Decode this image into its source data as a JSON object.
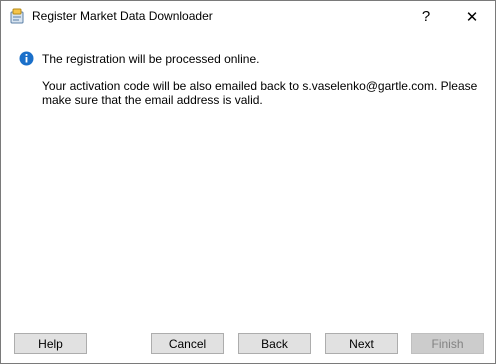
{
  "window": {
    "title": "Register Market Data Downloader",
    "help_glyph": "?",
    "close_glyph": "✕"
  },
  "message": {
    "lead": "The registration will be processed online.",
    "detail": "Your activation code will be also emailed back to s.vaselenko@gartle.com. Please make sure that the email address is valid."
  },
  "buttons": {
    "help": "Help",
    "cancel": "Cancel",
    "back": "Back",
    "next": "Next",
    "finish": "Finish"
  },
  "colors": {
    "accent": "#1a6fc9",
    "button_face": "#e1e1e1",
    "disabled_text": "#838383"
  }
}
